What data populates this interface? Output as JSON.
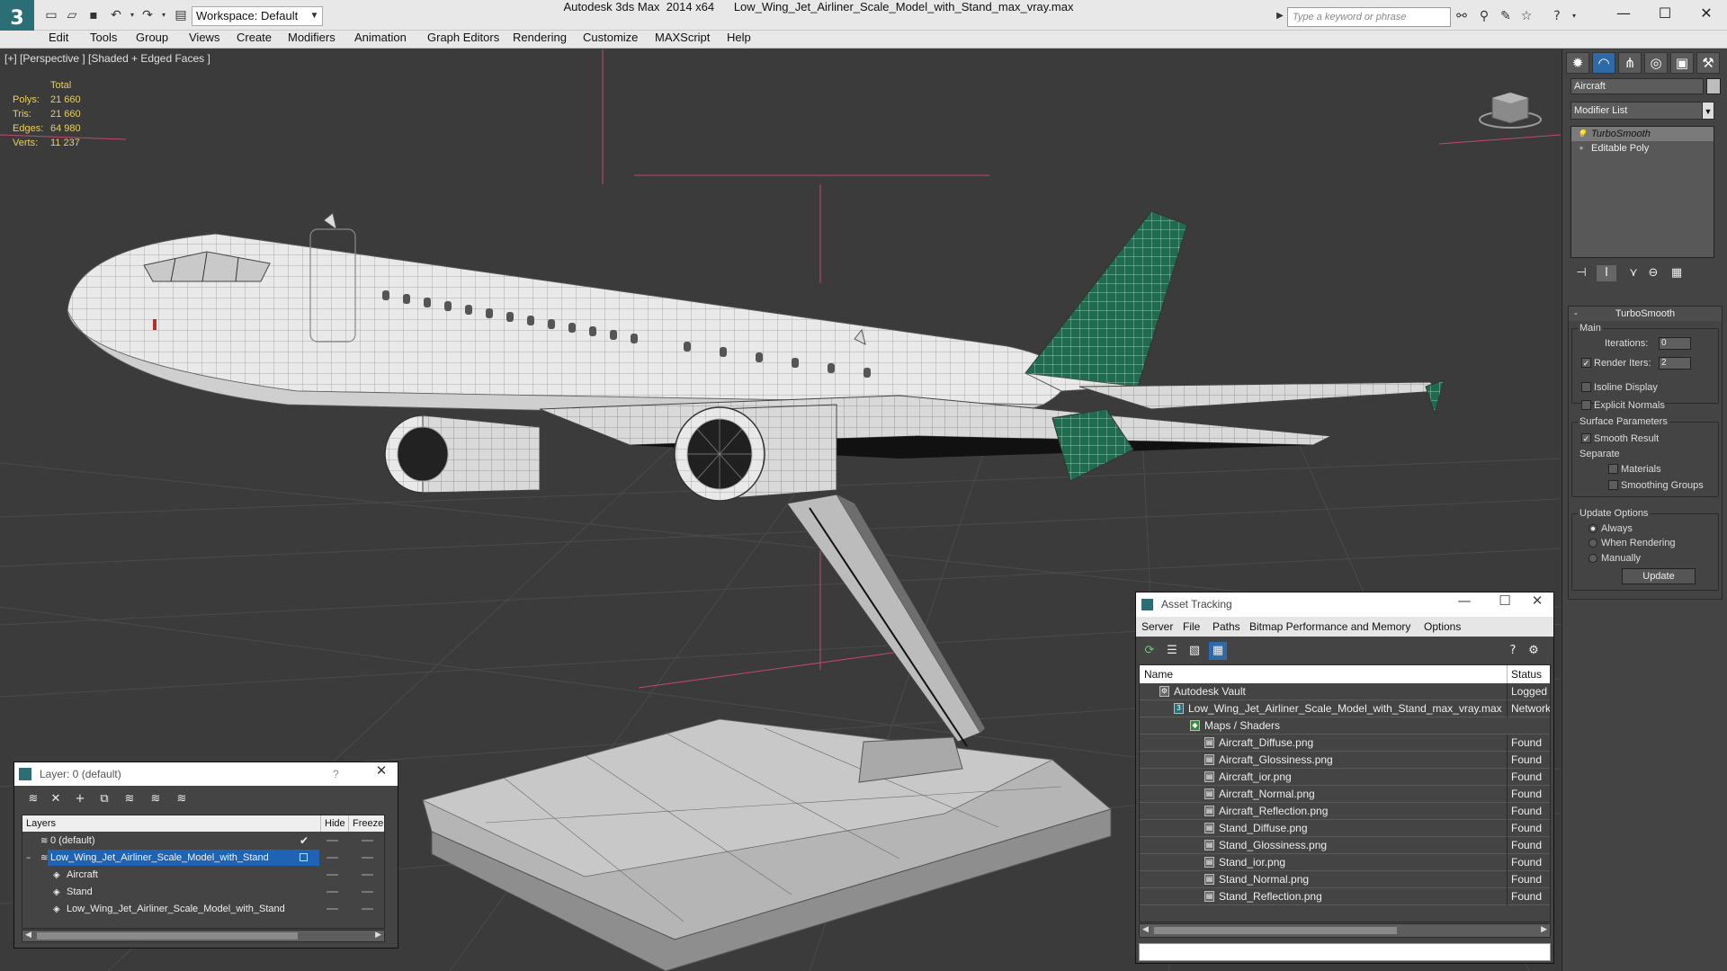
{
  "titlebar": {
    "app_title": "Autodesk 3ds Max  2014 x64      Low_Wing_Jet_Airliner_Scale_Model_with_Stand_max_vray.max",
    "workspace_label": "Workspace: Default",
    "search_placeholder": "Type a keyword or phrase",
    "logo": "3"
  },
  "menu": [
    "Edit",
    "Tools",
    "Group",
    "Views",
    "Create",
    "Modifiers",
    "Animation",
    "Graph Editors",
    "Rendering",
    "Customize",
    "MAXScript",
    "Help"
  ],
  "viewport": {
    "label": "[+] [Perspective ] [Shaded + Edged Faces ]",
    "stats_header": "Total",
    "stats": [
      {
        "label": "Polys:",
        "value": "21 660"
      },
      {
        "label": "Tris:",
        "value": "21 660"
      },
      {
        "label": "Edges:",
        "value": "64 980"
      },
      {
        "label": "Verts:",
        "value": "11 237"
      }
    ],
    "accent_color": "#1f6b50"
  },
  "command_panel": {
    "object_name": "Aircraft",
    "modifier_list": "Modifier List",
    "stack": [
      "TurboSmooth",
      "Editable Poly"
    ],
    "rollout_title": "TurboSmooth",
    "main_group": "Main",
    "iterations_label": "Iterations:",
    "iterations_value": "0",
    "render_iters_label": "Render Iters:",
    "render_iters_value": "2",
    "isoline_label": "Isoline Display",
    "explicit_normals_label": "Explicit Normals",
    "surface_group": "Surface Parameters",
    "smooth_result_label": "Smooth Result",
    "separate_label": "Separate",
    "materials_label": "Materials",
    "smoothing_groups_label": "Smoothing Groups",
    "update_group": "Update Options",
    "always_label": "Always",
    "when_rendering_label": "When Rendering",
    "manually_label": "Manually",
    "update_button": "Update"
  },
  "layer_window": {
    "title": "Layer: 0 (default)",
    "help": "?",
    "columns": {
      "layers": "Layers",
      "hide": "Hide",
      "freeze": "Freeze"
    },
    "rows": [
      {
        "name": "0 (default)"
      },
      {
        "name": "Low_Wing_Jet_Airliner_Scale_Model_with_Stand"
      },
      {
        "name": "Aircraft"
      },
      {
        "name": "Stand"
      },
      {
        "name": "Low_Wing_Jet_Airliner_Scale_Model_with_Stand"
      }
    ]
  },
  "asset_tracking": {
    "title": "Asset Tracking",
    "menu": [
      "Server",
      "File",
      "Paths",
      "Bitmap Performance and Memory",
      "Options"
    ],
    "columns": {
      "name": "Name",
      "status": "Status"
    },
    "rows": [
      {
        "name": "Autodesk Vault",
        "status": "Logged O"
      },
      {
        "name": "Low_Wing_Jet_Airliner_Scale_Model_with_Stand_max_vray.max",
        "status": "Network"
      },
      {
        "name": "Maps / Shaders",
        "status": ""
      },
      {
        "name": "Aircraft_Diffuse.png",
        "status": "Found"
      },
      {
        "name": "Aircraft_Glossiness.png",
        "status": "Found"
      },
      {
        "name": "Aircraft_ior.png",
        "status": "Found"
      },
      {
        "name": "Aircraft_Normal.png",
        "status": "Found"
      },
      {
        "name": "Aircraft_Reflection.png",
        "status": "Found"
      },
      {
        "name": "Stand_Diffuse.png",
        "status": "Found"
      },
      {
        "name": "Stand_Glossiness.png",
        "status": "Found"
      },
      {
        "name": "Stand_ior.png",
        "status": "Found"
      },
      {
        "name": "Stand_Normal.png",
        "status": "Found"
      },
      {
        "name": "Stand_Reflection.png",
        "status": "Found"
      }
    ]
  }
}
